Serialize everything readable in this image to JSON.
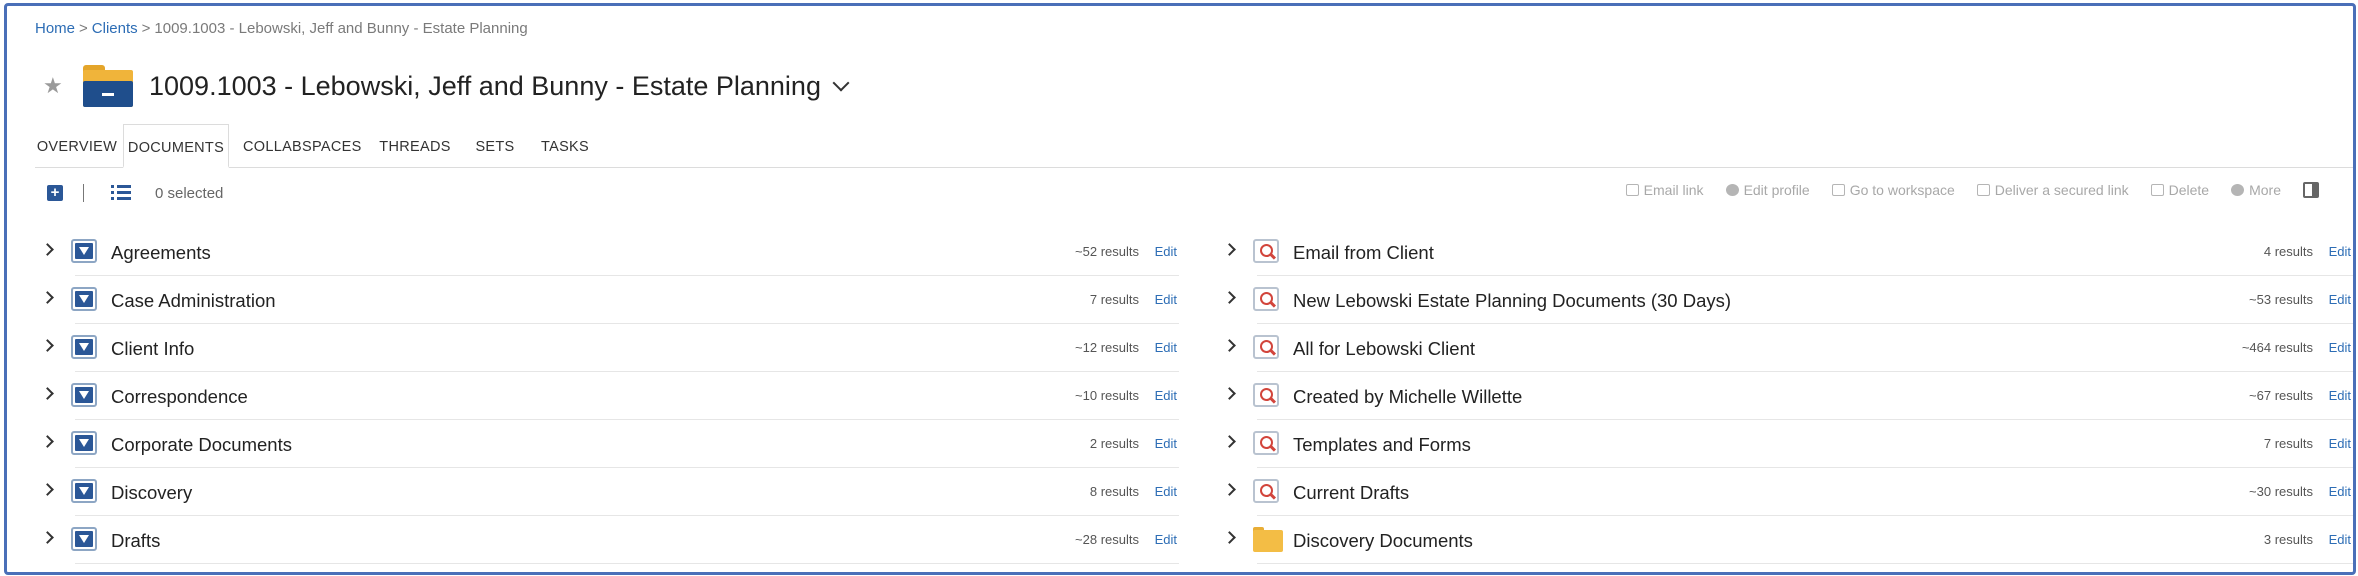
{
  "breadcrumb": {
    "home": "Home",
    "clients": "Clients",
    "separator": ">",
    "current": "1009.1003 - Lebowski, Jeff and Bunny - Estate Planning"
  },
  "header": {
    "title": "1009.1003 - Lebowski, Jeff and Bunny - Estate Planning",
    "star_icon": "★",
    "icon": "folder-icon"
  },
  "tabs": [
    {
      "label": "OVERVIEW",
      "active": false
    },
    {
      "label": "DOCUMENTS",
      "active": true
    },
    {
      "label": "COLLABSPACES",
      "active": false
    },
    {
      "label": "THREADS",
      "active": false
    },
    {
      "label": "SETS",
      "active": false
    },
    {
      "label": "TASKS",
      "active": false
    }
  ],
  "toolbar": {
    "add_icon": "+",
    "selected_text": "0 selected",
    "actions": [
      {
        "label": "Email link",
        "icon": "email-link-icon"
      },
      {
        "label": "Edit profile",
        "icon": "edit-profile-icon"
      },
      {
        "label": "Go to workspace",
        "icon": "briefcase-icon"
      },
      {
        "label": "Deliver a secured link",
        "icon": "secured-link-icon"
      },
      {
        "label": "Delete",
        "icon": "trash-icon"
      },
      {
        "label": "More",
        "icon": "more-icon"
      }
    ]
  },
  "left_folders": [
    {
      "name": "Agreements",
      "count": "~52 results",
      "edit": "Edit",
      "icon": "filter-folder-icon"
    },
    {
      "name": "Case Administration",
      "count": "7 results",
      "edit": "Edit",
      "icon": "filter-folder-icon"
    },
    {
      "name": "Client Info",
      "count": "~12 results",
      "edit": "Edit",
      "icon": "filter-folder-icon"
    },
    {
      "name": "Correspondence",
      "count": "~10 results",
      "edit": "Edit",
      "icon": "filter-folder-icon"
    },
    {
      "name": "Corporate Documents",
      "count": "2 results",
      "edit": "Edit",
      "icon": "filter-folder-icon"
    },
    {
      "name": "Discovery",
      "count": "8 results",
      "edit": "Edit",
      "icon": "filter-folder-icon"
    },
    {
      "name": "Drafts",
      "count": "~28 results",
      "edit": "Edit",
      "icon": "filter-folder-icon"
    }
  ],
  "right_folders": [
    {
      "name": "Email from Client",
      "count": "4 results",
      "edit": "Edit",
      "icon": "search-folder-icon"
    },
    {
      "name": "New Lebowski Estate Planning Documents (30 Days)",
      "count": "~53 results",
      "edit": "Edit",
      "icon": "search-folder-icon"
    },
    {
      "name": "All for Lebowski Client",
      "count": "~464 results",
      "edit": "Edit",
      "icon": "search-folder-icon"
    },
    {
      "name": "Created by Michelle Willette",
      "count": "~67 results",
      "edit": "Edit",
      "icon": "search-folder-icon"
    },
    {
      "name": "Templates and Forms",
      "count": "7 results",
      "edit": "Edit",
      "icon": "search-folder-icon"
    },
    {
      "name": "Current Drafts",
      "count": "~30 results",
      "edit": "Edit",
      "icon": "search-folder-icon"
    },
    {
      "name": "Discovery Documents",
      "count": "3 results",
      "edit": "Edit",
      "icon": "folder-icon"
    }
  ],
  "colors": {
    "accent": "#2b5797",
    "link": "#2d6db5",
    "folder": "#f0b43a",
    "frame": "#4a6fb8"
  }
}
